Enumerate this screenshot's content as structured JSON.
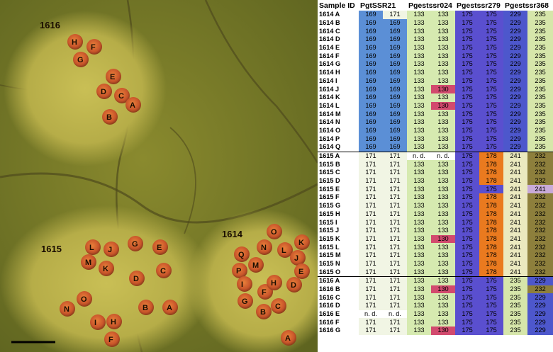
{
  "photo": {
    "pustule_groups": [
      "1616",
      "1615",
      "1614"
    ],
    "letters_1616": [
      "H",
      "F",
      "G",
      "E",
      "D",
      "C",
      "A",
      "B"
    ],
    "letters_1615": [
      "L",
      "J",
      "G",
      "E",
      "M",
      "K",
      "C",
      "D",
      "O",
      "N",
      "B",
      "A",
      "I",
      "H",
      "F"
    ],
    "letters_1614": [
      "O",
      "K",
      "Q",
      "N",
      "L",
      "M",
      "J",
      "P",
      "E",
      "I",
      "F",
      "H",
      "D",
      "G",
      "B",
      "C",
      "A"
    ]
  },
  "table": {
    "headers": [
      "Sample ID",
      "PgtSSR21",
      "Pgestssr024",
      "Pgestssr279",
      "Pgestssr368"
    ],
    "colors": {
      "c169": "#5b8fd6",
      "c171": "#f1f5e4",
      "c133": "#d6eab0",
      "c130": "#d24a6e",
      "c175": "#5a4fcf",
      "c178": "#ea7a1f",
      "c229": "#4d57cc",
      "c235": "#d6e6aa",
      "c241": "#ebe9bf",
      "c232": "#8d7f3c",
      "c241p": "#c9abd8",
      "nd": "#ffffff"
    },
    "rows": [
      {
        "id": "1614 A",
        "v": [
          "169",
          "171",
          "133",
          "133",
          "175",
          "175",
          "229",
          "235"
        ],
        "c": [
          "c169",
          "c171",
          "c133",
          "c133",
          "c175",
          "c175",
          "c229",
          "c235"
        ]
      },
      {
        "id": "1614 B",
        "v": [
          "169",
          "169",
          "133",
          "133",
          "175",
          "175",
          "229",
          "235"
        ],
        "c": [
          "c169",
          "c169",
          "c133",
          "c133",
          "c175",
          "c175",
          "c229",
          "c235"
        ]
      },
      {
        "id": "1614 C",
        "v": [
          "169",
          "169",
          "133",
          "133",
          "175",
          "175",
          "229",
          "235"
        ],
        "c": [
          "c169",
          "c169",
          "c133",
          "c133",
          "c175",
          "c175",
          "c229",
          "c235"
        ]
      },
      {
        "id": "1614 D",
        "v": [
          "169",
          "169",
          "133",
          "133",
          "175",
          "175",
          "229",
          "235"
        ],
        "c": [
          "c169",
          "c169",
          "c133",
          "c133",
          "c175",
          "c175",
          "c229",
          "c235"
        ]
      },
      {
        "id": "1614 E",
        "v": [
          "169",
          "169",
          "133",
          "133",
          "175",
          "175",
          "229",
          "235"
        ],
        "c": [
          "c169",
          "c169",
          "c133",
          "c133",
          "c175",
          "c175",
          "c229",
          "c235"
        ]
      },
      {
        "id": "1614 F",
        "v": [
          "169",
          "169",
          "133",
          "133",
          "175",
          "175",
          "229",
          "235"
        ],
        "c": [
          "c169",
          "c169",
          "c133",
          "c133",
          "c175",
          "c175",
          "c229",
          "c235"
        ]
      },
      {
        "id": "1614 G",
        "v": [
          "169",
          "169",
          "133",
          "133",
          "175",
          "175",
          "229",
          "235"
        ],
        "c": [
          "c169",
          "c169",
          "c133",
          "c133",
          "c175",
          "c175",
          "c229",
          "c235"
        ]
      },
      {
        "id": "1614 H",
        "v": [
          "169",
          "169",
          "133",
          "133",
          "175",
          "175",
          "229",
          "235"
        ],
        "c": [
          "c169",
          "c169",
          "c133",
          "c133",
          "c175",
          "c175",
          "c229",
          "c235"
        ]
      },
      {
        "id": "1614 I",
        "v": [
          "169",
          "169",
          "133",
          "133",
          "175",
          "175",
          "229",
          "235"
        ],
        "c": [
          "c169",
          "c169",
          "c133",
          "c133",
          "c175",
          "c175",
          "c229",
          "c235"
        ]
      },
      {
        "id": "1614 J",
        "v": [
          "169",
          "169",
          "133",
          "130",
          "175",
          "175",
          "229",
          "235"
        ],
        "c": [
          "c169",
          "c169",
          "c133",
          "c130",
          "c175",
          "c175",
          "c229",
          "c235"
        ]
      },
      {
        "id": "1614 K",
        "v": [
          "169",
          "169",
          "133",
          "133",
          "175",
          "175",
          "229",
          "235"
        ],
        "c": [
          "c169",
          "c169",
          "c133",
          "c133",
          "c175",
          "c175",
          "c229",
          "c235"
        ]
      },
      {
        "id": "1614 L",
        "v": [
          "169",
          "169",
          "133",
          "130",
          "175",
          "175",
          "229",
          "235"
        ],
        "c": [
          "c169",
          "c169",
          "c133",
          "c130",
          "c175",
          "c175",
          "c229",
          "c235"
        ]
      },
      {
        "id": "1614 M",
        "v": [
          "169",
          "169",
          "133",
          "133",
          "175",
          "175",
          "229",
          "235"
        ],
        "c": [
          "c169",
          "c169",
          "c133",
          "c133",
          "c175",
          "c175",
          "c229",
          "c235"
        ]
      },
      {
        "id": "1614 N",
        "v": [
          "169",
          "169",
          "133",
          "133",
          "175",
          "175",
          "229",
          "235"
        ],
        "c": [
          "c169",
          "c169",
          "c133",
          "c133",
          "c175",
          "c175",
          "c229",
          "c235"
        ]
      },
      {
        "id": "1614 O",
        "v": [
          "169",
          "169",
          "133",
          "133",
          "175",
          "175",
          "229",
          "235"
        ],
        "c": [
          "c169",
          "c169",
          "c133",
          "c133",
          "c175",
          "c175",
          "c229",
          "c235"
        ]
      },
      {
        "id": "1614 P",
        "v": [
          "169",
          "169",
          "133",
          "133",
          "175",
          "175",
          "229",
          "235"
        ],
        "c": [
          "c169",
          "c169",
          "c133",
          "c133",
          "c175",
          "c175",
          "c229",
          "c235"
        ]
      },
      {
        "id": "1614 Q",
        "v": [
          "169",
          "169",
          "133",
          "133",
          "175",
          "175",
          "229",
          "235"
        ],
        "c": [
          "c169",
          "c169",
          "c133",
          "c133",
          "c175",
          "c175",
          "c229",
          "c235"
        ]
      },
      {
        "id": "1615 A",
        "v": [
          "171",
          "171",
          "n. d.",
          "n. d.",
          "175",
          "178",
          "241",
          "232"
        ],
        "c": [
          "c171",
          "c171",
          "nd",
          "nd",
          "c175",
          "c178",
          "c241",
          "c232"
        ],
        "grp": true
      },
      {
        "id": "1615 B",
        "v": [
          "171",
          "171",
          "133",
          "133",
          "175",
          "178",
          "241",
          "232"
        ],
        "c": [
          "c171",
          "c171",
          "c133",
          "c133",
          "c175",
          "c178",
          "c241",
          "c232"
        ]
      },
      {
        "id": "1615 C",
        "v": [
          "171",
          "171",
          "133",
          "133",
          "175",
          "178",
          "241",
          "232"
        ],
        "c": [
          "c171",
          "c171",
          "c133",
          "c133",
          "c175",
          "c178",
          "c241",
          "c232"
        ]
      },
      {
        "id": "1615 D",
        "v": [
          "171",
          "171",
          "133",
          "133",
          "175",
          "178",
          "241",
          "232"
        ],
        "c": [
          "c171",
          "c171",
          "c133",
          "c133",
          "c175",
          "c178",
          "c241",
          "c232"
        ]
      },
      {
        "id": "1615 E",
        "v": [
          "171",
          "171",
          "133",
          "133",
          "175",
          "175",
          "241",
          "241"
        ],
        "c": [
          "c171",
          "c171",
          "c133",
          "c133",
          "c175",
          "c175",
          "c241",
          "c241p"
        ]
      },
      {
        "id": "1615 F",
        "v": [
          "171",
          "171",
          "133",
          "133",
          "175",
          "178",
          "241",
          "232"
        ],
        "c": [
          "c171",
          "c171",
          "c133",
          "c133",
          "c175",
          "c178",
          "c241",
          "c232"
        ]
      },
      {
        "id": "1615 G",
        "v": [
          "171",
          "171",
          "133",
          "133",
          "175",
          "178",
          "241",
          "232"
        ],
        "c": [
          "c171",
          "c171",
          "c133",
          "c133",
          "c175",
          "c178",
          "c241",
          "c232"
        ]
      },
      {
        "id": "1615 H",
        "v": [
          "171",
          "171",
          "133",
          "133",
          "175",
          "178",
          "241",
          "232"
        ],
        "c": [
          "c171",
          "c171",
          "c133",
          "c133",
          "c175",
          "c178",
          "c241",
          "c232"
        ]
      },
      {
        "id": "1615 I",
        "v": [
          "171",
          "171",
          "133",
          "133",
          "175",
          "178",
          "241",
          "232"
        ],
        "c": [
          "c171",
          "c171",
          "c133",
          "c133",
          "c175",
          "c178",
          "c241",
          "c232"
        ]
      },
      {
        "id": "1615 J",
        "v": [
          "171",
          "171",
          "133",
          "133",
          "175",
          "178",
          "241",
          "232"
        ],
        "c": [
          "c171",
          "c171",
          "c133",
          "c133",
          "c175",
          "c178",
          "c241",
          "c232"
        ]
      },
      {
        "id": "1615 K",
        "v": [
          "171",
          "171",
          "133",
          "130",
          "175",
          "178",
          "241",
          "232"
        ],
        "c": [
          "c171",
          "c171",
          "c133",
          "c130",
          "c175",
          "c178",
          "c241",
          "c232"
        ]
      },
      {
        "id": "1615 L",
        "v": [
          "171",
          "171",
          "133",
          "133",
          "175",
          "178",
          "241",
          "232"
        ],
        "c": [
          "c171",
          "c171",
          "c133",
          "c133",
          "c175",
          "c178",
          "c241",
          "c232"
        ]
      },
      {
        "id": "1615 M",
        "v": [
          "171",
          "171",
          "133",
          "133",
          "175",
          "178",
          "241",
          "232"
        ],
        "c": [
          "c171",
          "c171",
          "c133",
          "c133",
          "c175",
          "c178",
          "c241",
          "c232"
        ]
      },
      {
        "id": "1615 N",
        "v": [
          "171",
          "171",
          "133",
          "133",
          "175",
          "178",
          "241",
          "232"
        ],
        "c": [
          "c171",
          "c171",
          "c133",
          "c133",
          "c175",
          "c178",
          "c241",
          "c232"
        ]
      },
      {
        "id": "1615 O",
        "v": [
          "171",
          "171",
          "133",
          "133",
          "175",
          "178",
          "241",
          "232"
        ],
        "c": [
          "c171",
          "c171",
          "c133",
          "c133",
          "c175",
          "c178",
          "c241",
          "c232"
        ]
      },
      {
        "id": "1616 A",
        "v": [
          "171",
          "171",
          "133",
          "133",
          "175",
          "175",
          "235",
          "229"
        ],
        "c": [
          "c171",
          "c171",
          "c133",
          "c133",
          "c175",
          "c175",
          "c235",
          "c229"
        ],
        "grp": true
      },
      {
        "id": "1616 B",
        "v": [
          "171",
          "171",
          "133",
          "130",
          "175",
          "175",
          "235",
          "232"
        ],
        "c": [
          "c171",
          "c171",
          "c133",
          "c130",
          "c175",
          "c175",
          "c235",
          "c232"
        ]
      },
      {
        "id": "1616 C",
        "v": [
          "171",
          "171",
          "133",
          "133",
          "175",
          "175",
          "235",
          "229"
        ],
        "c": [
          "c171",
          "c171",
          "c133",
          "c133",
          "c175",
          "c175",
          "c235",
          "c229"
        ]
      },
      {
        "id": "1616 D",
        "v": [
          "171",
          "171",
          "133",
          "133",
          "175",
          "175",
          "235",
          "229"
        ],
        "c": [
          "c171",
          "c171",
          "c133",
          "c133",
          "c175",
          "c175",
          "c235",
          "c229"
        ]
      },
      {
        "id": "1616 E",
        "v": [
          "n. d.",
          "n. d.",
          "133",
          "133",
          "175",
          "175",
          "235",
          "229"
        ],
        "c": [
          "nd",
          "nd",
          "c133",
          "c133",
          "c175",
          "c175",
          "c235",
          "c229"
        ]
      },
      {
        "id": "1616 F",
        "v": [
          "171",
          "171",
          "133",
          "133",
          "175",
          "175",
          "235",
          "229"
        ],
        "c": [
          "c171",
          "c171",
          "c133",
          "c133",
          "c175",
          "c175",
          "c235",
          "c229"
        ]
      },
      {
        "id": "1616 G",
        "v": [
          "171",
          "171",
          "133",
          "130",
          "175",
          "175",
          "235",
          "229"
        ],
        "c": [
          "c171",
          "c171",
          "c133",
          "c130",
          "c175",
          "c175",
          "c235",
          "c229"
        ]
      }
    ]
  }
}
